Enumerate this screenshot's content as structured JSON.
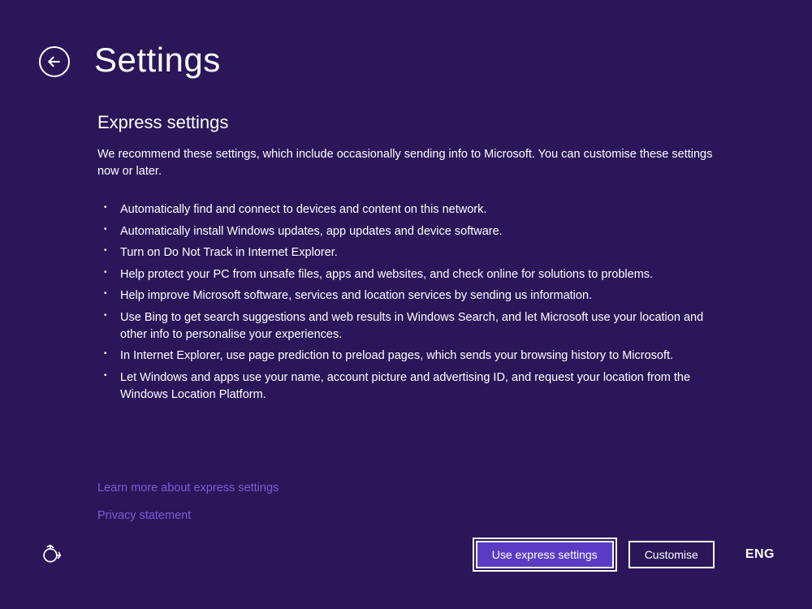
{
  "header": {
    "title": "Settings"
  },
  "main": {
    "subtitle": "Express settings",
    "intro": "We recommend these settings, which include occasionally sending info to Microsoft. You can customise these settings now or later.",
    "bullets": [
      "Automatically find and connect to devices and content on this network.",
      "Automatically install Windows updates, app updates and device software.",
      "Turn on Do Not Track in Internet Explorer.",
      "Help protect your PC from unsafe files, apps and websites, and check online for solutions to problems.",
      "Help improve Microsoft software, services and location services by sending us information.",
      "Use Bing to get search suggestions and web results in Windows Search, and let Microsoft use your location and other info to personalise your experiences.",
      "In Internet Explorer, use page prediction to preload pages, which sends your browsing history to Microsoft.",
      "Let Windows and apps use your name, account picture and advertising ID, and request your location from the Windows Location Platform."
    ],
    "links": {
      "learn_more": "Learn more about express settings",
      "privacy": "Privacy statement"
    }
  },
  "footer": {
    "primary_button": "Use express settings",
    "secondary_button": "Customise",
    "language": "ENG"
  }
}
